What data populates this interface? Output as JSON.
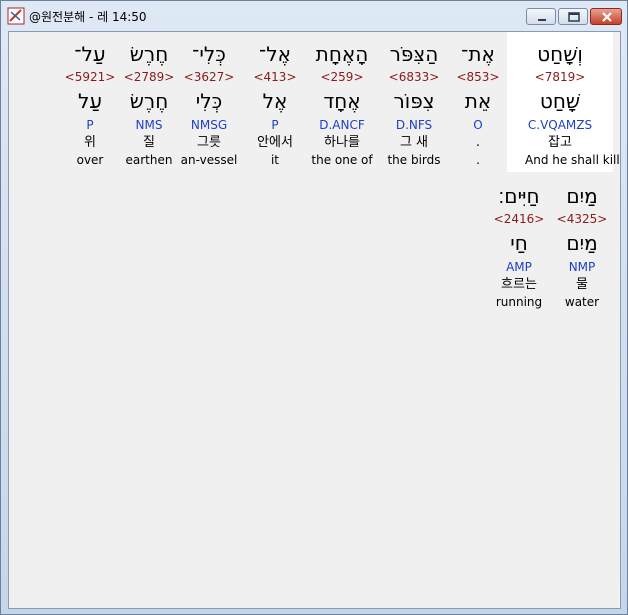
{
  "window": {
    "title": "@원전분해 - 레 14:50"
  },
  "colors": {
    "strong": "#8b1a1a",
    "grammar": "#1f3fc4",
    "selection": "#ffffff"
  },
  "words_row1": [
    {
      "hebrew": "וְשָׁחַט",
      "strong": "<7819>",
      "lemma": "שָׁחַט",
      "grammar": "C.VQAMZS",
      "korean": "잡고",
      "english": "And he shall kill"
    },
    {
      "hebrew": "אֶת־",
      "strong": "<853>",
      "lemma": "אֵת",
      "grammar": "O",
      "korean": ".",
      "english": "."
    },
    {
      "hebrew": "הַצִּפֹּר",
      "strong": "<6833>",
      "lemma": "צִפּוֹר",
      "grammar": "D.NFS",
      "korean": "그 새",
      "english": "the birds"
    },
    {
      "hebrew": "הָאֶחָת",
      "strong": "<259>",
      "lemma": "אֶחָד",
      "grammar": "D.ANCF",
      "korean": "하나를",
      "english": "the one of"
    },
    {
      "hebrew": "אֶל־",
      "strong": "<413>",
      "lemma": "אֶל",
      "grammar": "P",
      "korean": "안에서",
      "english": "it"
    },
    {
      "hebrew": "כְּלִי־",
      "strong": "<3627>",
      "lemma": "כְּלִי",
      "grammar": "NMSG",
      "korean": "그릇",
      "english": "an-vessel"
    },
    {
      "hebrew": "חֶרֶשׂ",
      "strong": "<2789>",
      "lemma": "חֶרֶשׂ",
      "grammar": "NMS",
      "korean": "질",
      "english": "earthen"
    },
    {
      "hebrew": "עַל־",
      "strong": "<5921>",
      "lemma": "עַל",
      "grammar": "P",
      "korean": "위",
      "english": "over"
    }
  ],
  "words_row2": [
    {
      "hebrew": "מַיִם",
      "strong": "<4325>",
      "lemma": "מַיִם",
      "grammar": "NMP",
      "korean": "물",
      "english": "water"
    },
    {
      "hebrew": "חַיִּים׃",
      "strong": "<2416>",
      "lemma": "חַי",
      "grammar": "AMP",
      "korean": "흐르는",
      "english": "running"
    }
  ]
}
